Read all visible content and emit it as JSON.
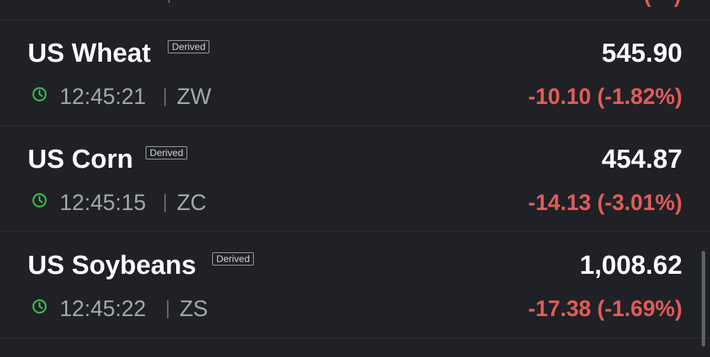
{
  "top_strip": {
    "separator": "|",
    "change_tail": "(   )"
  },
  "rows": [
    {
      "name": "US Wheat",
      "badge": "Derived",
      "price": "545.90",
      "time": "12:45:21",
      "symbol": "ZW",
      "change": "-10.10 (-1.82%)"
    },
    {
      "name": "US Corn",
      "badge": "Derived",
      "price": "454.87",
      "time": "12:45:15",
      "symbol": "ZC",
      "change": "-14.13 (-3.01%)"
    },
    {
      "name": "US Soybeans",
      "badge": "Derived",
      "price": "1,008.62",
      "time": "12:45:22",
      "symbol": "ZS",
      "change": "-17.38 (-1.69%)"
    }
  ],
  "icons": {
    "time": "clock-icon"
  },
  "colors": {
    "background": "#1f2126",
    "negative": "#e25b58",
    "clock": "#3dbb4f",
    "muted": "#a3a6ac"
  }
}
